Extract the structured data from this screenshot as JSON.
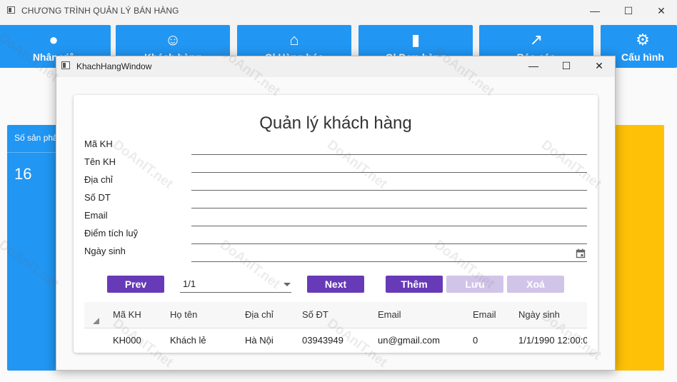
{
  "app": {
    "title": "CHƯƠNG TRÌNH QUẢN LÝ BÁN HÀNG",
    "minimize_glyph": "—",
    "maximize_glyph": "☐",
    "close_glyph": "✕"
  },
  "menu": [
    {
      "label": "Nhân viê",
      "icon": "account-circle-icon",
      "glyph": "●"
    },
    {
      "label": "Khách hàng",
      "icon": "emoticon-icon",
      "glyph": "☺"
    },
    {
      "label": "Ql Hàng hóa",
      "icon": "basket-icon",
      "glyph": "⌂"
    },
    {
      "label": "Ql Đơn hàng",
      "icon": "receipt-icon",
      "glyph": "▮"
    },
    {
      "label": "Báo cáo",
      "icon": "chart-line-icon",
      "glyph": "↗"
    },
    {
      "label": "Cấu hình",
      "icon": "gear-icon",
      "glyph": "⚙"
    }
  ],
  "stat_card": {
    "title": "Số sản phẩm",
    "value": "16"
  },
  "dialog": {
    "title": "KhachHangWindow",
    "heading": "Quản lý khách hàng",
    "fields": [
      {
        "label": "Mã KH",
        "value": ""
      },
      {
        "label": "Tên KH",
        "value": ""
      },
      {
        "label": "Địa chỉ",
        "value": ""
      },
      {
        "label": "Số DT",
        "value": ""
      },
      {
        "label": "Email",
        "value": ""
      },
      {
        "label": "Điểm tích luỹ",
        "value": ""
      },
      {
        "label": "Ngày sinh",
        "value": ""
      }
    ],
    "buttons": {
      "prev": "Prev",
      "next": "Next",
      "add": "Thêm",
      "save": "Lưu",
      "delete": "Xoá"
    },
    "pager": {
      "value": "1/1"
    },
    "grid": {
      "columns": [
        "Mã KH",
        "Họ tên",
        "Địa chỉ",
        "Số ĐT",
        "Email",
        "Email",
        "Ngày sinh"
      ],
      "rows": [
        [
          "KH000",
          "Khách lẻ",
          "Hà Nội",
          "03943949",
          "un@gmail.com",
          "0",
          "1/1/1990 12:00:0"
        ]
      ]
    }
  },
  "watermark": "DoAnIT.net"
}
